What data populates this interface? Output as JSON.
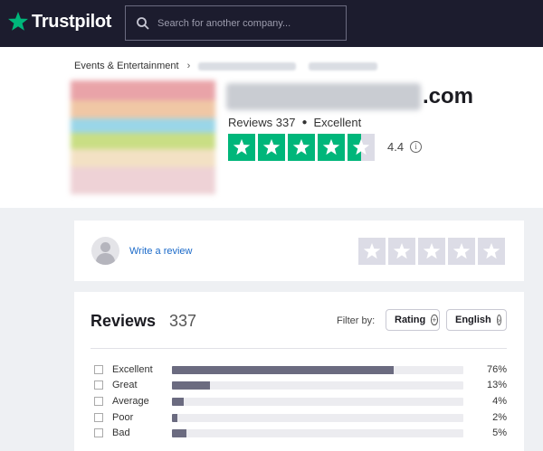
{
  "header": {
    "logo_text": "Trustpilot",
    "logo_icon": "star-icon",
    "search_placeholder": "Search for another company...",
    "bg_color": "#1c1c2e"
  },
  "company": {
    "breadcrumb_first": "Events & Entertainment",
    "domain_suffix": ".com",
    "reviews_label": "Reviews 337",
    "rating_word": "Excellent",
    "score": "4.4",
    "star_color": "#00b67a",
    "stars_filled": 4.5
  },
  "write_review": {
    "link_text": "Write a review"
  },
  "reviews": {
    "title": "Reviews",
    "count": "337",
    "filter_label": "Filter by:",
    "rating_button": "Rating",
    "language_button": "English",
    "rows": [
      {
        "label": "Excellent",
        "percent": "76%",
        "value": 76
      },
      {
        "label": "Great",
        "percent": "13%",
        "value": 13
      },
      {
        "label": "Average",
        "percent": "4%",
        "value": 4
      },
      {
        "label": "Poor",
        "percent": "2%",
        "value": 2
      },
      {
        "label": "Bad",
        "percent": "5%",
        "value": 5
      }
    ]
  }
}
